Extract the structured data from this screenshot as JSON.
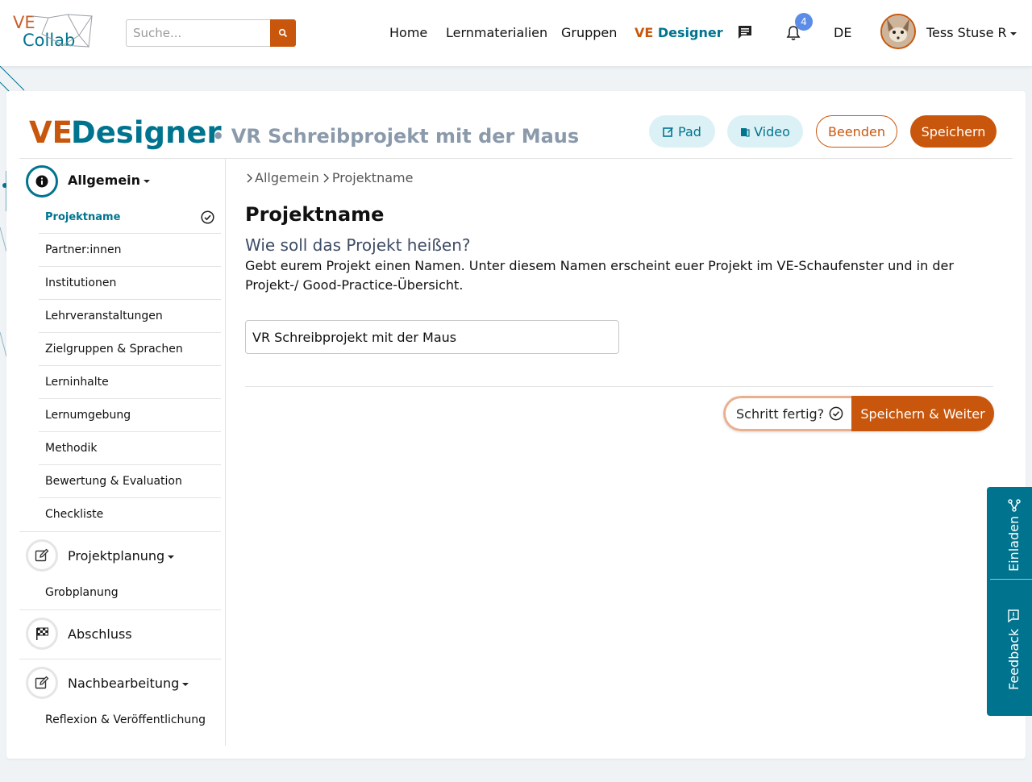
{
  "logo": {
    "ve": "VE",
    "collab": "Collab"
  },
  "search": {
    "placeholder": "Suche..."
  },
  "nav": {
    "home": "Home",
    "materials": "Lernmaterialien",
    "groups": "Gruppen",
    "designer_ve": "VE",
    "designer_rest": "Designer",
    "notif_count": "4",
    "language": "DE",
    "user": "Tess Stuse R"
  },
  "header": {
    "title_ve": "VE",
    "title_designer": "Designer",
    "subtitle": "• VR Schreibprojekt mit der Maus",
    "pad_label": "Pad",
    "video_label": "Video",
    "end_label": "Beenden",
    "save_label": "Speichern"
  },
  "sidebar": {
    "general": "Allgemein",
    "general_items": [
      "Projektname",
      "Partner:innen",
      "Institutionen",
      "Lehrveranstaltungen",
      "Zielgruppen & Sprachen",
      "Lerninhalte",
      "Lernumgebung",
      "Methodik",
      "Bewertung & Evaluation",
      "Checkliste"
    ],
    "planning": "Projektplanung",
    "planning_items": [
      "Grobplanung"
    ],
    "closing": "Abschluss",
    "followup": "Nachbearbeitung",
    "followup_items": [
      "Reflexion & Veröffentlichung"
    ]
  },
  "content": {
    "breadcrumb": [
      "Allgemein",
      "Projektname"
    ],
    "heading": "Projektname",
    "question": "Wie soll das Projekt heißen?",
    "description": "Gebt eurem Projekt einen Namen. Unter diesem Namen erscheint euer Projekt im VE-Schaufenster und in der Projekt-/ Good-Practice-Übersicht.",
    "project_name_value": "VR Schreibprojekt mit der Maus",
    "step_done_label": "Schritt fertig?",
    "save_next_label": "Speichern & Weiter"
  },
  "sidetabs": {
    "invite": "Einladen",
    "feedback": "Feedback"
  },
  "colors": {
    "brand_orange": "#c8570d",
    "brand_teal": "#00748f"
  }
}
